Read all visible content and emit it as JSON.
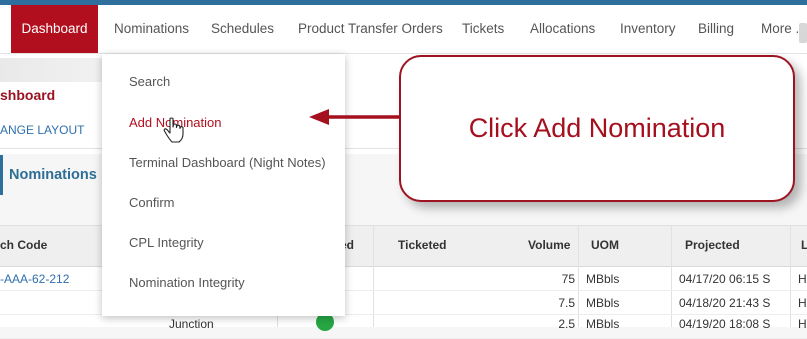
{
  "nav": {
    "items": [
      {
        "label": "Dashboard",
        "active": true
      },
      {
        "label": "Nominations"
      },
      {
        "label": "Schedules"
      },
      {
        "label": "Product Transfer Orders"
      },
      {
        "label": "Tickets"
      },
      {
        "label": "Allocations"
      },
      {
        "label": "Inventory"
      },
      {
        "label": "Billing"
      },
      {
        "label": "More ..."
      }
    ]
  },
  "page": {
    "title_partial": "shboard",
    "change_layout_partial": "ANGE LAYOUT",
    "section_title": "Nominations"
  },
  "dropdown": {
    "items": [
      {
        "label": "Search"
      },
      {
        "label": "Add Nomination",
        "active": true
      },
      {
        "label": "Terminal Dashboard (Night Notes)"
      },
      {
        "label": "Confirm"
      },
      {
        "label": "CPL Integrity"
      },
      {
        "label": "Nomination Integrity"
      }
    ]
  },
  "callout": {
    "text": "Click Add Nomination"
  },
  "table": {
    "columns": [
      "ch Code",
      "ed",
      "Ticketed",
      "Volume",
      "UOM",
      "Projected",
      "L"
    ],
    "rows": [
      {
        "code": "-AAA-62-212",
        "volume": "75",
        "uom": "MBbls",
        "projected": "04/17/20 06:15 S",
        "last": "H"
      },
      {
        "code": "",
        "volume": "7.5",
        "uom": "MBbls",
        "projected": "04/18/20 21:43 S",
        "last": "H"
      },
      {
        "code": "",
        "junction": "Junction",
        "volume": "2.5",
        "uom": "MBbls",
        "projected": "04/19/20 18:08 S",
        "last": "H"
      }
    ]
  },
  "colors": {
    "brand_red": "#b10f1e",
    "link_blue": "#2f6fae",
    "success_green": "#27a744"
  },
  "icons": {
    "cursor": "hand-pointer-icon",
    "status": "check-circle-icon"
  }
}
